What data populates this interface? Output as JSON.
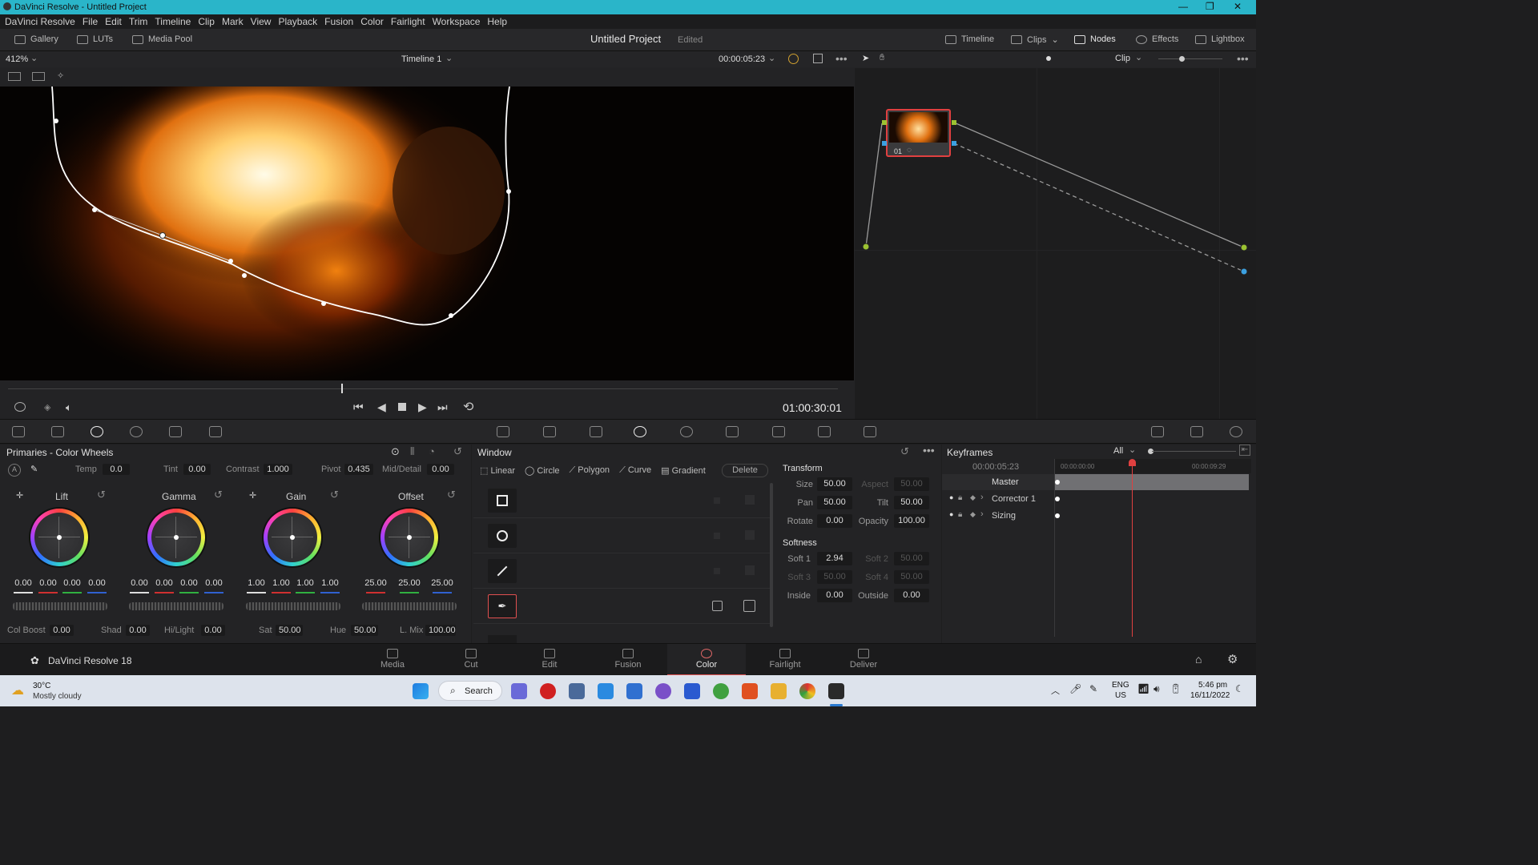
{
  "titlebar": {
    "title": "DaVinci Resolve - Untitled Project"
  },
  "menu": [
    "DaVinci Resolve",
    "File",
    "Edit",
    "Trim",
    "Timeline",
    "Clip",
    "Mark",
    "View",
    "Playback",
    "Fusion",
    "Color",
    "Fairlight",
    "Workspace",
    "Help"
  ],
  "header": {
    "gallery": "Gallery",
    "luts": "LUTs",
    "media_pool": "Media Pool",
    "project": "Untitled Project",
    "status": "Edited",
    "timeline": "Timeline",
    "clips": "Clips",
    "nodes": "Nodes",
    "effects": "Effects",
    "lightbox": "Lightbox"
  },
  "viewer": {
    "zoom": "412%",
    "timeline_name": "Timeline 1",
    "timecode": "00:00:05:23",
    "playhead_timecode": "01:00:30:01"
  },
  "nodes": {
    "mode": "Clip",
    "node_label": "01"
  },
  "wheels": {
    "title": "Primaries - Color Wheels",
    "temp_label": "Temp",
    "temp": "0.0",
    "tint_label": "Tint",
    "tint": "0.00",
    "contrast_label": "Contrast",
    "contrast": "1.000",
    "pivot_label": "Pivot",
    "pivot": "0.435",
    "middetail_label": "Mid/Detail",
    "middetail": "0.00",
    "lift": {
      "label": "Lift",
      "values": [
        "0.00",
        "0.00",
        "0.00",
        "0.00"
      ]
    },
    "gamma": {
      "label": "Gamma",
      "values": [
        "0.00",
        "0.00",
        "0.00",
        "0.00"
      ]
    },
    "gain": {
      "label": "Gain",
      "values": [
        "1.00",
        "1.00",
        "1.00",
        "1.00"
      ]
    },
    "offset": {
      "label": "Offset",
      "values": [
        "25.00",
        "25.00",
        "25.00"
      ]
    },
    "colboost_label": "Col Boost",
    "colboost": "0.00",
    "shad_label": "Shad",
    "shad": "0.00",
    "hilight_label": "Hi/Light",
    "hilight": "0.00",
    "sat_label": "Sat",
    "sat": "50.00",
    "hue_label": "Hue",
    "hue": "50.00",
    "lmix_label": "L. Mix",
    "lmix": "100.00"
  },
  "window": {
    "title": "Window",
    "tools": [
      "Linear",
      "Circle",
      "Polygon",
      "Curve",
      "Gradient"
    ],
    "delete": "Delete",
    "transform_title": "Transform",
    "size_label": "Size",
    "size": "50.00",
    "aspect_label": "Aspect",
    "aspect": "50.00",
    "pan_label": "Pan",
    "pan": "50.00",
    "tilt_label": "Tilt",
    "tilt": "50.00",
    "rotate_label": "Rotate",
    "rotate": "0.00",
    "opacity_label": "Opacity",
    "opacity": "100.00",
    "softness_title": "Softness",
    "soft1_label": "Soft 1",
    "soft1": "2.94",
    "soft2_label": "Soft 2",
    "soft2": "50.00",
    "soft3_label": "Soft 3",
    "soft3": "50.00",
    "soft4_label": "Soft 4",
    "soft4": "50.00",
    "inside_label": "Inside",
    "inside": "0.00",
    "outside_label": "Outside",
    "outside": "0.00"
  },
  "keyframes": {
    "title": "Keyframes",
    "filter": "All",
    "timecode": "00:00:05:23",
    "ruler_start": "00:00:00:00",
    "ruler_end": "00:00:09:29",
    "tracks": [
      "Master",
      "Corrector 1",
      "Sizing"
    ]
  },
  "pages": {
    "brand": "DaVinci Resolve 18",
    "items": [
      "Media",
      "Cut",
      "Edit",
      "Fusion",
      "Color",
      "Fairlight",
      "Deliver"
    ],
    "active": "Color"
  },
  "taskbar": {
    "temp": "30°C",
    "weather": "Mostly cloudy",
    "search": "Search",
    "lang1": "ENG",
    "lang2": "US",
    "time": "5:46 pm",
    "date": "16/11/2022"
  }
}
